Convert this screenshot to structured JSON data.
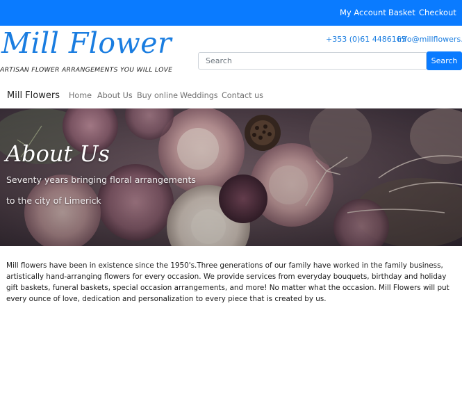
{
  "topbar": {
    "color": "#0a7bff",
    "links": [
      "My Account",
      "Basket",
      "Checkout"
    ]
  },
  "header": {
    "title": "Mill Flower",
    "tagline": "ARTISAN FLOWER ARRANGEMENTS YOU WILL LOVE",
    "phone": "+353 (0)61 4486165",
    "email": "info@millflowers.ie",
    "brand_color": "#1a7de0"
  },
  "search": {
    "placeholder": "Search",
    "button_label": "Search"
  },
  "nav": {
    "brand": "Mill Flowers",
    "items": [
      "Home",
      "About Us",
      "Buy online",
      "Weddings",
      "Contact us"
    ]
  },
  "hero": {
    "title": "About Us",
    "line1": "Seventy years bringing floral arrangements",
    "line2": "to the city of Limerick"
  },
  "about": {
    "body": "Mill flowers have been in existence since the 1950's.Three generations of our family have worked in the family business, artistically hand-arranging flowers for every occasion. We provide services from everyday bouquets, birthday and holiday gift baskets, funeral baskets, special occasion arrangements, and more! No matter what the occasion. Mill Flowers will put every ounce of love, dedication and personalization to every piece that is created by us."
  }
}
